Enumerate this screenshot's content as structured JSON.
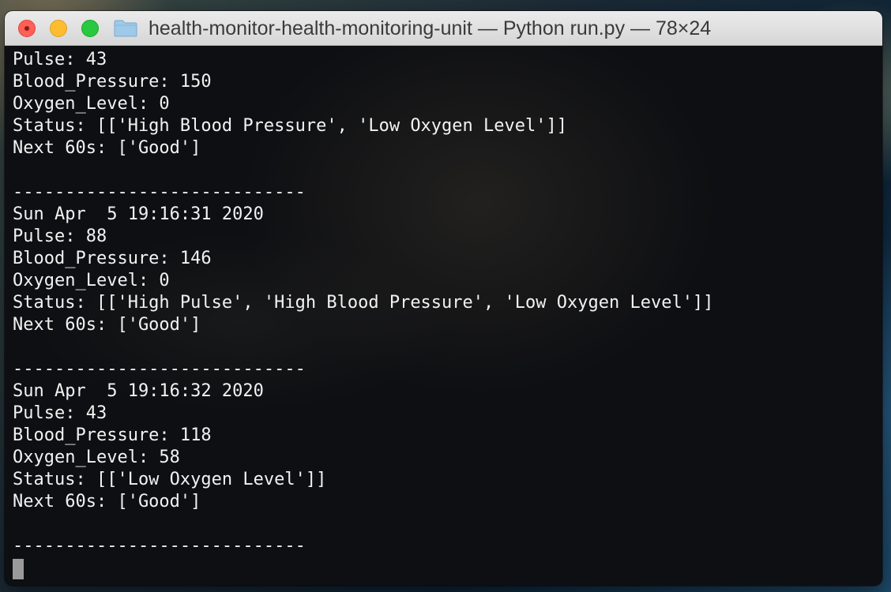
{
  "window": {
    "title": "health-monitor-health-monitoring-unit — Python run.py — 78×24"
  },
  "terminal": {
    "lines": [
      "Pulse: 43",
      "Blood_Pressure: 150",
      "Oxygen_Level: 0",
      "Status: [['High Blood Pressure', 'Low Oxygen Level']]",
      "Next 60s: ['Good']",
      "",
      "----------------------------",
      "Sun Apr  5 19:16:31 2020",
      "Pulse: 88",
      "Blood_Pressure: 146",
      "Oxygen_Level: 0",
      "Status: [['High Pulse', 'High Blood Pressure', 'Low Oxygen Level']]",
      "Next 60s: ['Good']",
      "",
      "----------------------------",
      "Sun Apr  5 19:16:32 2020",
      "Pulse: 43",
      "Blood_Pressure: 118",
      "Oxygen_Level: 58",
      "Status: [['Low Oxygen Level']]",
      "Next 60s: ['Good']",
      "",
      "----------------------------"
    ]
  },
  "icons": {
    "close": "close-button",
    "minimize": "minimize-button",
    "zoom": "zoom-button",
    "folder": "folder-icon"
  },
  "colors": {
    "close": "#fe5f57",
    "minimize": "#febc2e",
    "zoom": "#28c840",
    "terminal_text": "#f2f2f2",
    "terminal_bg": "#0e0f12"
  }
}
